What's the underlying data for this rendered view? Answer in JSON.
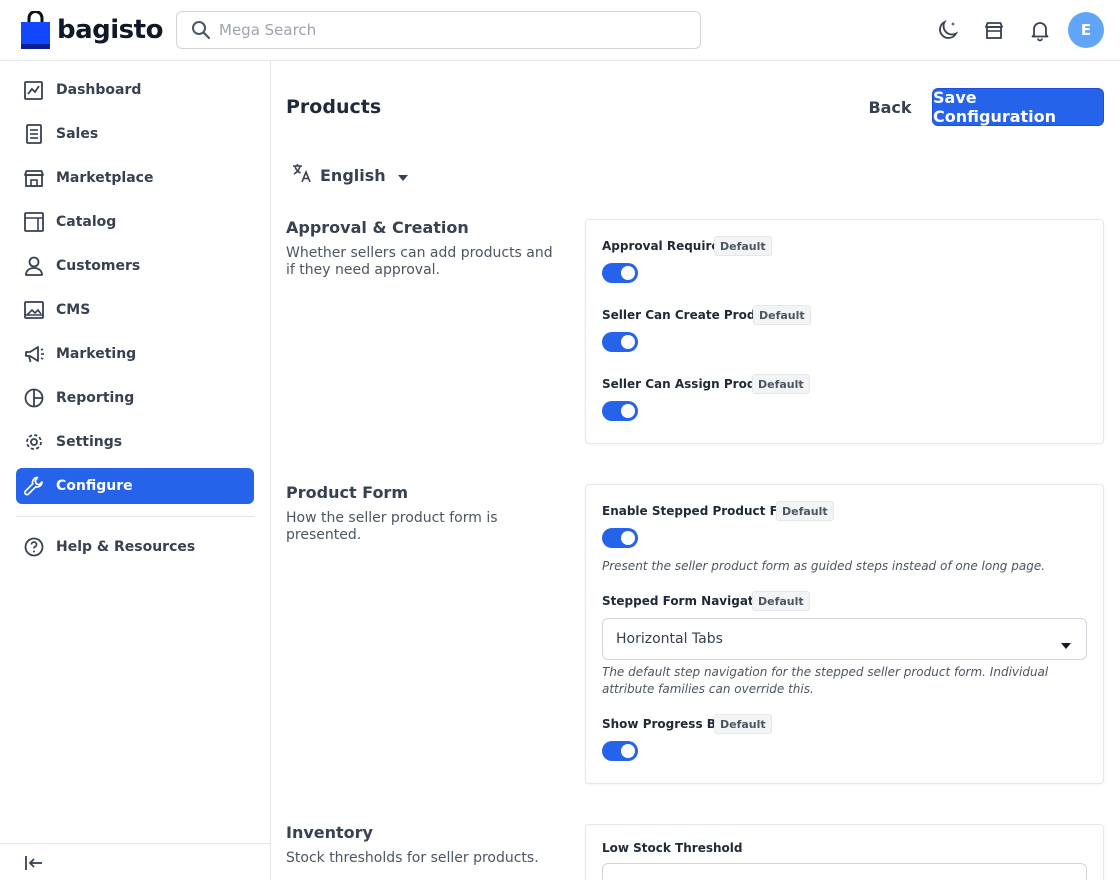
{
  "header": {
    "brand": "bagisto",
    "search_placeholder": "Mega Search",
    "avatar_initial": "E"
  },
  "sidebar": {
    "items": [
      {
        "label": "Dashboard",
        "icon": "dashboard-icon"
      },
      {
        "label": "Sales",
        "icon": "receipt-icon"
      },
      {
        "label": "Marketplace",
        "icon": "store-icon"
      },
      {
        "label": "Catalog",
        "icon": "catalog-icon"
      },
      {
        "label": "Customers",
        "icon": "user-icon"
      },
      {
        "label": "CMS",
        "icon": "image-icon"
      },
      {
        "label": "Marketing",
        "icon": "megaphone-icon"
      },
      {
        "label": "Reporting",
        "icon": "pie-chart-icon"
      },
      {
        "label": "Settings",
        "icon": "gear-icon"
      },
      {
        "label": "Configure",
        "icon": "wrench-icon",
        "active": true
      }
    ],
    "help_label": "Help & Resources"
  },
  "main": {
    "title": "Products",
    "back_label": "Back",
    "save_label": "Save Configuration",
    "locale": "English"
  },
  "sections": {
    "approval": {
      "title": "Approval & Creation",
      "description": "Whether sellers can add products and if they need approval.",
      "fields": [
        {
          "label": "Approval Required",
          "badge": "Default",
          "enabled": true
        },
        {
          "label": "Seller Can Create Product",
          "badge": "Default",
          "enabled": true
        },
        {
          "label": "Seller Can Assign Product",
          "badge": "Default",
          "enabled": true
        }
      ]
    },
    "product_form": {
      "title": "Product Form",
      "description": "How the seller product form is presented.",
      "stepped": {
        "label": "Enable Stepped Product Form",
        "badge": "Default",
        "enabled": true,
        "hint": "Present the seller product form as guided steps instead of one long page."
      },
      "navigation": {
        "label": "Stepped Form Navigation",
        "badge": "Default",
        "value": "Horizontal Tabs",
        "hint": "The default step navigation for the stepped seller product form. Individual attribute families can override this."
      },
      "progress": {
        "label": "Show Progress Bar",
        "badge": "Default",
        "enabled": true
      }
    },
    "inventory": {
      "title": "Inventory",
      "description": "Stock thresholds for seller products.",
      "low_stock_label": "Low Stock Threshold"
    }
  },
  "colors": {
    "accent": "#2563eb",
    "avatar": "#60a5fa"
  }
}
